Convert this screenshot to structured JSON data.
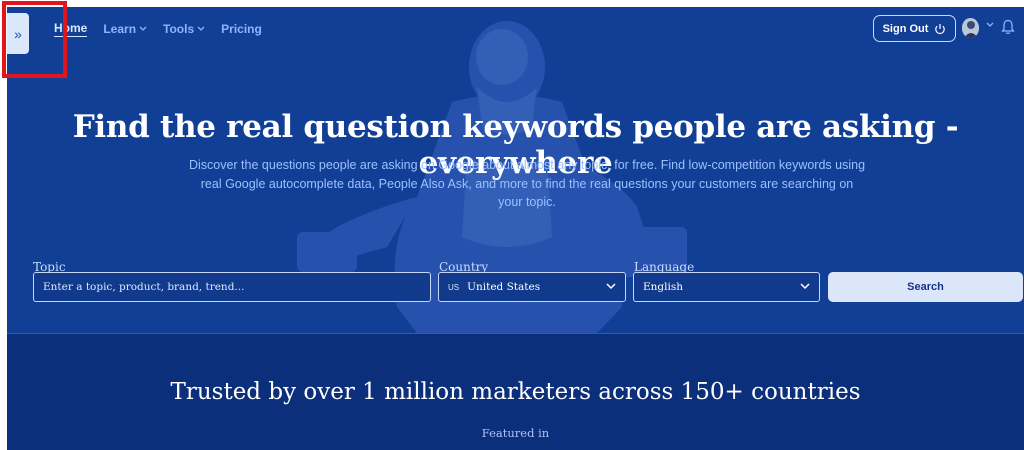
{
  "nav": {
    "sidebar_toggle_icon": "»",
    "items": [
      {
        "label": "Home"
      },
      {
        "label": "Learn"
      },
      {
        "label": "Tools"
      },
      {
        "label": "Pricing"
      }
    ],
    "chevron": "⌄"
  },
  "header": {
    "sign_out_label": "Sign Out"
  },
  "hero": {
    "headline": "Find the real question keywords people are asking - everywhere",
    "subtext": "Discover the questions people are asking on Google about almost any topic, for free. Find low-competition keywords using real Google autocomplete data, People Also Ask, and more to find the real questions your customers are searching on your topic."
  },
  "form": {
    "topic_label": "Topic",
    "topic_placeholder": "Enter a topic, product, brand, trend...",
    "country_label": "Country",
    "country_flag": "US",
    "country_value": "United States",
    "language_label": "Language",
    "language_value": "English",
    "search_label": "Search"
  },
  "trust": {
    "headline": "Trusted by over 1 million marketers across 150+ countries",
    "featured_label": "Featured in"
  },
  "colors": {
    "hero_bg": "#123f96",
    "page_bg": "#0b2f7a",
    "accent": "#dbe6fb",
    "highlight": "#e0161c"
  }
}
